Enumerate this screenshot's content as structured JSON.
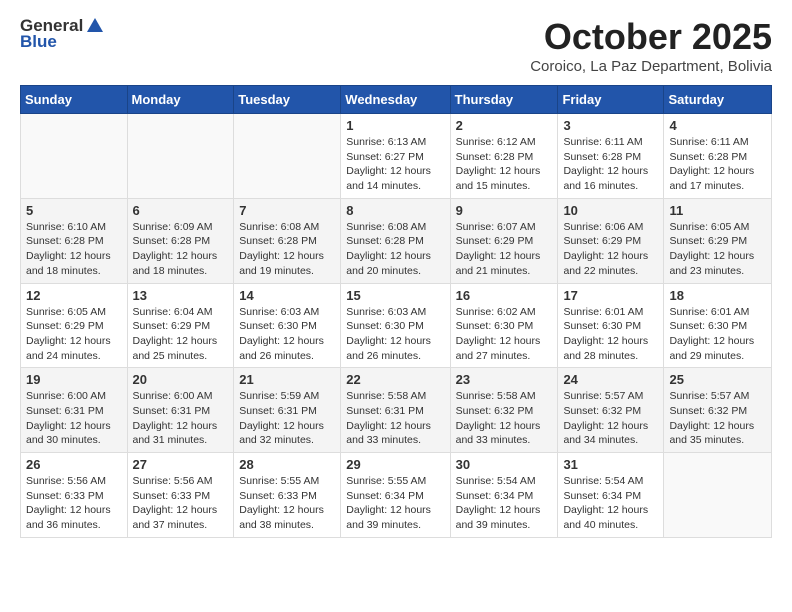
{
  "logo": {
    "text_general": "General",
    "text_blue": "Blue"
  },
  "header": {
    "month": "October 2025",
    "location": "Coroico, La Paz Department, Bolivia"
  },
  "weekdays": [
    "Sunday",
    "Monday",
    "Tuesday",
    "Wednesday",
    "Thursday",
    "Friday",
    "Saturday"
  ],
  "weeks": [
    [
      {
        "day": "",
        "sunrise": "",
        "sunset": "",
        "daylight": ""
      },
      {
        "day": "",
        "sunrise": "",
        "sunset": "",
        "daylight": ""
      },
      {
        "day": "",
        "sunrise": "",
        "sunset": "",
        "daylight": ""
      },
      {
        "day": "1",
        "sunrise": "Sunrise: 6:13 AM",
        "sunset": "Sunset: 6:27 PM",
        "daylight": "Daylight: 12 hours and 14 minutes."
      },
      {
        "day": "2",
        "sunrise": "Sunrise: 6:12 AM",
        "sunset": "Sunset: 6:28 PM",
        "daylight": "Daylight: 12 hours and 15 minutes."
      },
      {
        "day": "3",
        "sunrise": "Sunrise: 6:11 AM",
        "sunset": "Sunset: 6:28 PM",
        "daylight": "Daylight: 12 hours and 16 minutes."
      },
      {
        "day": "4",
        "sunrise": "Sunrise: 6:11 AM",
        "sunset": "Sunset: 6:28 PM",
        "daylight": "Daylight: 12 hours and 17 minutes."
      }
    ],
    [
      {
        "day": "5",
        "sunrise": "Sunrise: 6:10 AM",
        "sunset": "Sunset: 6:28 PM",
        "daylight": "Daylight: 12 hours and 18 minutes."
      },
      {
        "day": "6",
        "sunrise": "Sunrise: 6:09 AM",
        "sunset": "Sunset: 6:28 PM",
        "daylight": "Daylight: 12 hours and 18 minutes."
      },
      {
        "day": "7",
        "sunrise": "Sunrise: 6:08 AM",
        "sunset": "Sunset: 6:28 PM",
        "daylight": "Daylight: 12 hours and 19 minutes."
      },
      {
        "day": "8",
        "sunrise": "Sunrise: 6:08 AM",
        "sunset": "Sunset: 6:28 PM",
        "daylight": "Daylight: 12 hours and 20 minutes."
      },
      {
        "day": "9",
        "sunrise": "Sunrise: 6:07 AM",
        "sunset": "Sunset: 6:29 PM",
        "daylight": "Daylight: 12 hours and 21 minutes."
      },
      {
        "day": "10",
        "sunrise": "Sunrise: 6:06 AM",
        "sunset": "Sunset: 6:29 PM",
        "daylight": "Daylight: 12 hours and 22 minutes."
      },
      {
        "day": "11",
        "sunrise": "Sunrise: 6:05 AM",
        "sunset": "Sunset: 6:29 PM",
        "daylight": "Daylight: 12 hours and 23 minutes."
      }
    ],
    [
      {
        "day": "12",
        "sunrise": "Sunrise: 6:05 AM",
        "sunset": "Sunset: 6:29 PM",
        "daylight": "Daylight: 12 hours and 24 minutes."
      },
      {
        "day": "13",
        "sunrise": "Sunrise: 6:04 AM",
        "sunset": "Sunset: 6:29 PM",
        "daylight": "Daylight: 12 hours and 25 minutes."
      },
      {
        "day": "14",
        "sunrise": "Sunrise: 6:03 AM",
        "sunset": "Sunset: 6:30 PM",
        "daylight": "Daylight: 12 hours and 26 minutes."
      },
      {
        "day": "15",
        "sunrise": "Sunrise: 6:03 AM",
        "sunset": "Sunset: 6:30 PM",
        "daylight": "Daylight: 12 hours and 26 minutes."
      },
      {
        "day": "16",
        "sunrise": "Sunrise: 6:02 AM",
        "sunset": "Sunset: 6:30 PM",
        "daylight": "Daylight: 12 hours and 27 minutes."
      },
      {
        "day": "17",
        "sunrise": "Sunrise: 6:01 AM",
        "sunset": "Sunset: 6:30 PM",
        "daylight": "Daylight: 12 hours and 28 minutes."
      },
      {
        "day": "18",
        "sunrise": "Sunrise: 6:01 AM",
        "sunset": "Sunset: 6:30 PM",
        "daylight": "Daylight: 12 hours and 29 minutes."
      }
    ],
    [
      {
        "day": "19",
        "sunrise": "Sunrise: 6:00 AM",
        "sunset": "Sunset: 6:31 PM",
        "daylight": "Daylight: 12 hours and 30 minutes."
      },
      {
        "day": "20",
        "sunrise": "Sunrise: 6:00 AM",
        "sunset": "Sunset: 6:31 PM",
        "daylight": "Daylight: 12 hours and 31 minutes."
      },
      {
        "day": "21",
        "sunrise": "Sunrise: 5:59 AM",
        "sunset": "Sunset: 6:31 PM",
        "daylight": "Daylight: 12 hours and 32 minutes."
      },
      {
        "day": "22",
        "sunrise": "Sunrise: 5:58 AM",
        "sunset": "Sunset: 6:31 PM",
        "daylight": "Daylight: 12 hours and 33 minutes."
      },
      {
        "day": "23",
        "sunrise": "Sunrise: 5:58 AM",
        "sunset": "Sunset: 6:32 PM",
        "daylight": "Daylight: 12 hours and 33 minutes."
      },
      {
        "day": "24",
        "sunrise": "Sunrise: 5:57 AM",
        "sunset": "Sunset: 6:32 PM",
        "daylight": "Daylight: 12 hours and 34 minutes."
      },
      {
        "day": "25",
        "sunrise": "Sunrise: 5:57 AM",
        "sunset": "Sunset: 6:32 PM",
        "daylight": "Daylight: 12 hours and 35 minutes."
      }
    ],
    [
      {
        "day": "26",
        "sunrise": "Sunrise: 5:56 AM",
        "sunset": "Sunset: 6:33 PM",
        "daylight": "Daylight: 12 hours and 36 minutes."
      },
      {
        "day": "27",
        "sunrise": "Sunrise: 5:56 AM",
        "sunset": "Sunset: 6:33 PM",
        "daylight": "Daylight: 12 hours and 37 minutes."
      },
      {
        "day": "28",
        "sunrise": "Sunrise: 5:55 AM",
        "sunset": "Sunset: 6:33 PM",
        "daylight": "Daylight: 12 hours and 38 minutes."
      },
      {
        "day": "29",
        "sunrise": "Sunrise: 5:55 AM",
        "sunset": "Sunset: 6:34 PM",
        "daylight": "Daylight: 12 hours and 39 minutes."
      },
      {
        "day": "30",
        "sunrise": "Sunrise: 5:54 AM",
        "sunset": "Sunset: 6:34 PM",
        "daylight": "Daylight: 12 hours and 39 minutes."
      },
      {
        "day": "31",
        "sunrise": "Sunrise: 5:54 AM",
        "sunset": "Sunset: 6:34 PM",
        "daylight": "Daylight: 12 hours and 40 minutes."
      },
      {
        "day": "",
        "sunrise": "",
        "sunset": "",
        "daylight": ""
      }
    ]
  ]
}
